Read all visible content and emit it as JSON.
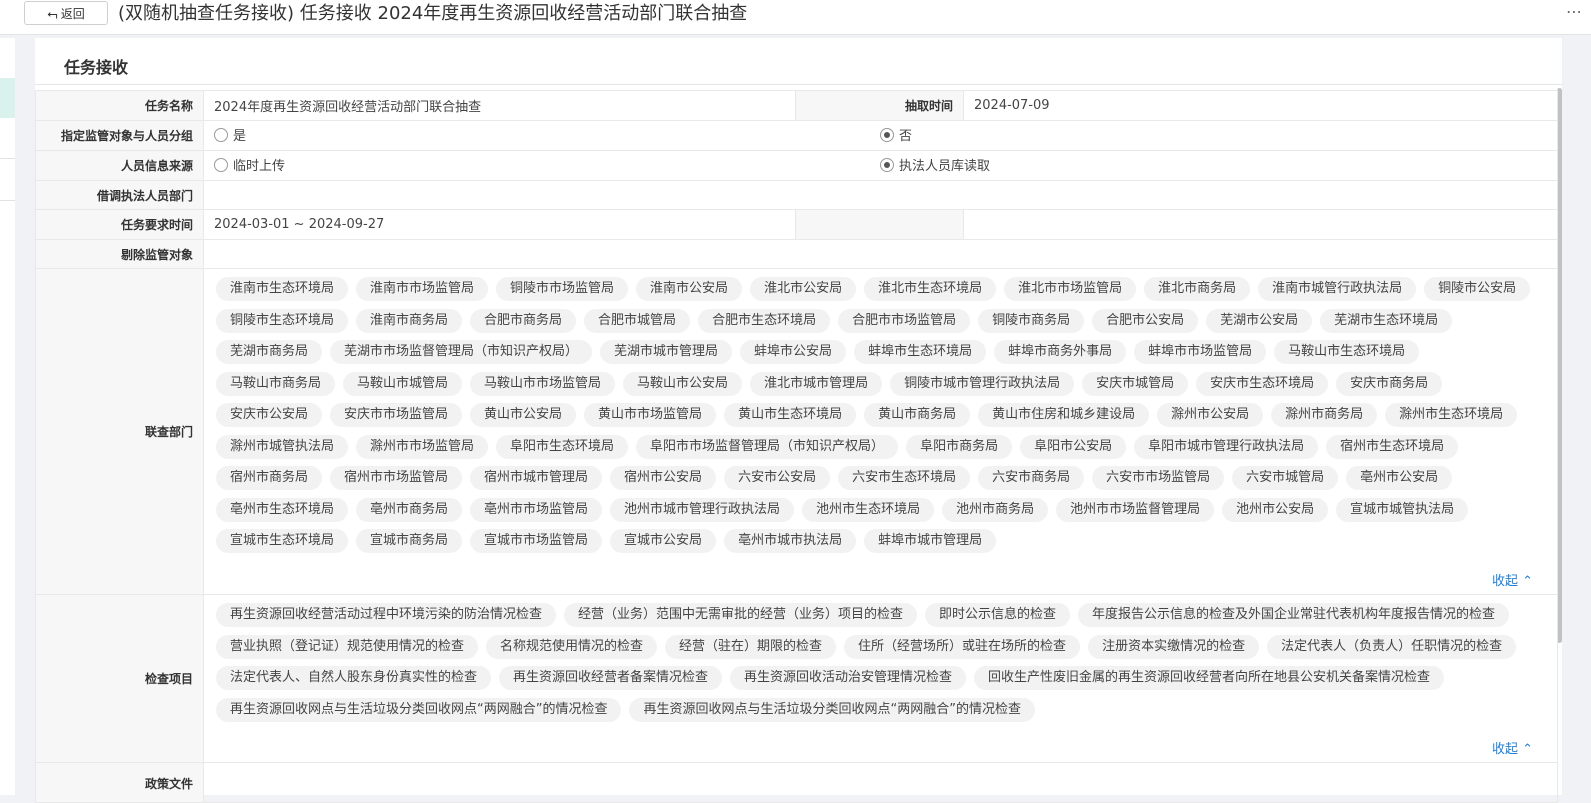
{
  "header": {
    "back_label": "返回",
    "title": "(双随机抽查任务接收) 任务接收 2024年度再生资源回收经营活动部门联合抽查",
    "more": "⋯"
  },
  "section": {
    "title": "任务接收"
  },
  "form": {
    "task_name_label": "任务名称",
    "task_name": "2024年度再生资源回收经营活动部门联合抽查",
    "draw_time_label": "抽取时间",
    "draw_time": "2024-07-09",
    "assign_label": "指定监管对象与人员分组",
    "assign_yes": "是",
    "assign_no": "否",
    "source_label": "人员信息来源",
    "source_temp": "临时上传",
    "source_db": "执法人员库读取",
    "borrow_label": "借调执法人员部门",
    "req_time_label": "任务要求时间",
    "req_time": "2024-03-01 ~ 2024-09-27",
    "exclude_label": "剔除监管对象",
    "depts_label": "联查部门",
    "items_label": "检查项目",
    "collapse_label": "收起",
    "policy_label": "政策文件"
  },
  "departments": [
    "淮南市生态环境局",
    "淮南市市场监管局",
    "铜陵市市场监管局",
    "淮南市公安局",
    "淮北市公安局",
    "淮北市生态环境局",
    "淮北市市场监管局",
    "淮北市商务局",
    "淮南市城管行政执法局",
    "铜陵市公安局",
    "铜陵市生态环境局",
    "淮南市商务局",
    "合肥市商务局",
    "合肥市城管局",
    "合肥市生态环境局",
    "合肥市市场监管局",
    "铜陵市商务局",
    "合肥市公安局",
    "芜湖市公安局",
    "芜湖市生态环境局",
    "芜湖市商务局",
    "芜湖市市场监督管理局（市知识产权局）",
    "芜湖市城市管理局",
    "蚌埠市公安局",
    "蚌埠市生态环境局",
    "蚌埠市商务外事局",
    "蚌埠市市场监管局",
    "马鞍山市生态环境局",
    "马鞍山市商务局",
    "马鞍山市城管局",
    "马鞍山市市场监管局",
    "马鞍山市公安局",
    "淮北市城市管理局",
    "铜陵市城市管理行政执法局",
    "安庆市城管局",
    "安庆市生态环境局",
    "安庆市商务局",
    "安庆市公安局",
    "安庆市市场监管局",
    "黄山市公安局",
    "黄山市市场监管局",
    "黄山市生态环境局",
    "黄山市商务局",
    "黄山市住房和城乡建设局",
    "滁州市公安局",
    "滁州市商务局",
    "滁州市生态环境局",
    "滁州市城管执法局",
    "滁州市市场监管局",
    "阜阳市生态环境局",
    "阜阳市市场监督管理局（市知识产权局）",
    "阜阳市商务局",
    "阜阳市公安局",
    "阜阳市城市管理行政执法局",
    "宿州市生态环境局",
    "宿州市商务局",
    "宿州市市场监管局",
    "宿州市城市管理局",
    "宿州市公安局",
    "六安市公安局",
    "六安市生态环境局",
    "六安市商务局",
    "六安市市场监管局",
    "六安市城管局",
    "亳州市公安局",
    "亳州市生态环境局",
    "亳州市商务局",
    "亳州市市场监管局",
    "池州市城市管理行政执法局",
    "池州市生态环境局",
    "池州市商务局",
    "池州市市场监督管理局",
    "池州市公安局",
    "宣城市城管执法局",
    "宣城市生态环境局",
    "宣城市商务局",
    "宣城市市场监管局",
    "宣城市公安局",
    "亳州市城市执法局",
    "蚌埠市城市管理局"
  ],
  "check_items": [
    "再生资源回收经营活动过程中环境污染的防治情况检查",
    "经营（业务）范围中无需审批的经营（业务）项目的检查",
    "即时公示信息的检查",
    "年度报告公示信息的检查及外国企业常驻代表机构年度报告情况的检查",
    "营业执照（登记证）规范使用情况的检查",
    "名称规范使用情况的检查",
    "经营（驻在）期限的检查",
    "住所（经营场所）或驻在场所的检查",
    "注册资本实缴情况的检查",
    "法定代表人（负责人）任职情况的检查",
    "法定代表人、自然人股东身份真实性的检查",
    "再生资源回收经营者备案情况检查",
    "再生资源回收活动治安管理情况检查",
    "回收生产性废旧金属的再生资源回收经营者向所在地县公安机关备案情况检查",
    "再生资源回收网点与生活垃圾分类回收网点“两网融合”的情况检查",
    "再生资源回收网点与生活垃圾分类回收网点“两网融合”的情况检查"
  ]
}
